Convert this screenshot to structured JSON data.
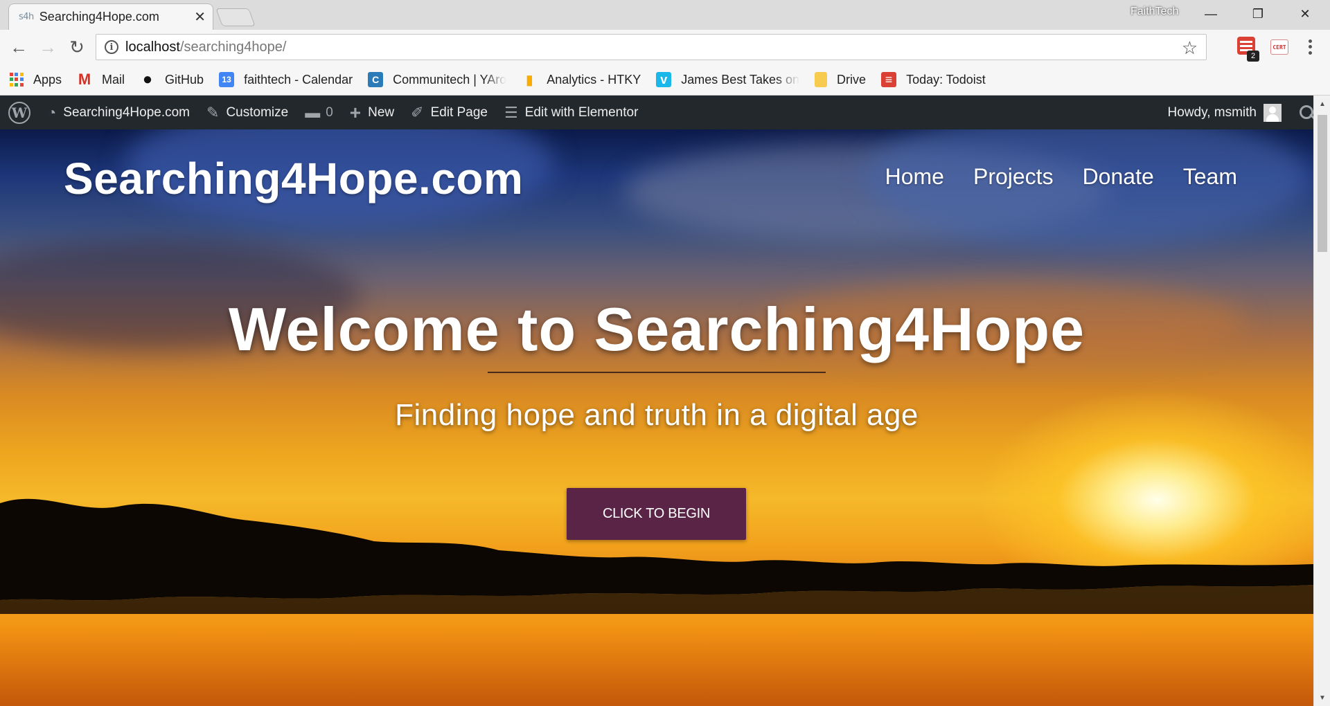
{
  "browser": {
    "tab": {
      "favicon_text": "s4h",
      "title": "Searching4Hope.com",
      "close_glyph": "✕"
    },
    "profile_name": "FaithTech",
    "window_controls": {
      "minimize": "—",
      "restore": "❐",
      "close": "✕"
    },
    "nav": {
      "back": "←",
      "forward": "→",
      "reload": "↻"
    },
    "omnibox": {
      "info_glyph": "i",
      "url_host": "localhost",
      "url_path": "/searching4hope/",
      "star_glyph": "☆"
    },
    "extensions": {
      "todoist_badge": "2",
      "cert_label": "CERT"
    },
    "bookmarks": [
      {
        "label": "Apps",
        "icon": "apps-grid-icon"
      },
      {
        "label": "Mail",
        "icon": "gmail-icon",
        "glyph": "M",
        "color": "#d93025"
      },
      {
        "label": "GitHub",
        "icon": "github-icon",
        "glyph": "●",
        "color": "#111111"
      },
      {
        "label": "faithtech - Calendar",
        "icon": "calendar-icon",
        "glyph": "13",
        "color": "#4285f4"
      },
      {
        "label": "Communitech | YAro",
        "icon": "communitech-icon",
        "glyph": "C",
        "color": "#2b7bb9"
      },
      {
        "label": "Analytics - HTKY",
        "icon": "analytics-icon",
        "glyph": "▮",
        "color": "#f9ab00"
      },
      {
        "label": "James Best Takes on",
        "icon": "vimeo-icon",
        "glyph": "v",
        "color": "#1ab7ea"
      },
      {
        "label": "Drive",
        "icon": "drive-folder-icon",
        "glyph": " ",
        "color": "#f7cb4d"
      },
      {
        "label": "Today: Todoist",
        "icon": "todoist-icon",
        "glyph": "≡",
        "color": "#db4035"
      }
    ]
  },
  "adminbar": {
    "wp_logo_glyph": "W",
    "site_name": "Searching4Hope.com",
    "customize": "Customize",
    "comments_count": "0",
    "new": "New",
    "edit_page": "Edit Page",
    "edit_elementor": "Edit with Elementor",
    "howdy": "Howdy, msmith",
    "icons": {
      "dashboard": "◔",
      "customize": "✎",
      "comments": "▬",
      "new": "+",
      "edit_page": "✐",
      "elementor": "☰"
    }
  },
  "hero": {
    "logo": "Searching4Hope.com",
    "nav": [
      "Home",
      "Projects",
      "Donate",
      "Team"
    ],
    "title": "Welcome to Searching4Hope",
    "subtitle": "Finding hope and truth in a digital age",
    "cta": "CLICK TO BEGIN",
    "cta_color": "#5a2446"
  },
  "scrollbar": {
    "up": "▲",
    "down": "▼"
  }
}
